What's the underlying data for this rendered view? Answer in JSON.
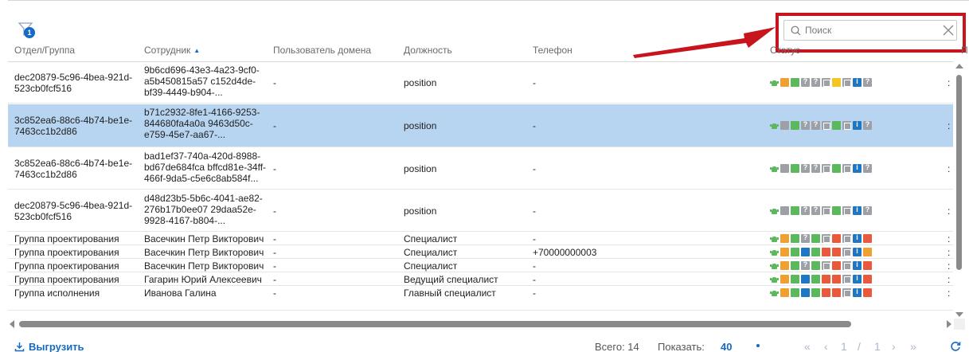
{
  "filter": {
    "badge_count": "1",
    "icon": "funnel-icon"
  },
  "search": {
    "placeholder": "Поиск",
    "value": ""
  },
  "columns": {
    "department": "Отдел/Группа",
    "employee": "Сотрудник",
    "domain_user": "Пользователь домена",
    "position": "Должность",
    "phone": "Телефон",
    "status": "Статус",
    "extra": "П"
  },
  "status_colors": {
    "green": "#5cb85c",
    "orange": "#f0a030",
    "red": "#e95a3c",
    "yellow": "#f3c623",
    "blue": "#1f77c4",
    "gray": "#9da0a5"
  },
  "rows": [
    {
      "department": "dec20879-5c96-4bea-921d-523cb0fcf516",
      "employee": "9b6cd696-43e3-4a23-9cf0-a5b450815a57 c152d4de-bf39-4449-b904-...",
      "domain_user": "-",
      "position": "position",
      "phone": "-",
      "selected": false,
      "status_icons": [
        "android",
        "o",
        "g",
        "gr-q",
        "gr-q",
        "gr-box",
        "y",
        "gr-box",
        "b-inf",
        "gr-q"
      ]
    },
    {
      "department": "3c852ea6-88c6-4b74-be1e-7463cc1b2d86",
      "employee": "b71c2932-8fe1-4166-9253-844680fa4a0a 9463d50c-e759-45e7-aa67-...",
      "domain_user": "-",
      "position": "position",
      "phone": "-",
      "selected": true,
      "status_icons": [
        "android",
        "gr",
        "g",
        "gr-q",
        "gr-q",
        "gr-box",
        "g",
        "gr-box",
        "b-inf",
        "gr-q"
      ]
    },
    {
      "department": "3c852ea6-88c6-4b74-be1e-7463cc1b2d86",
      "employee": "bad1ef37-740a-420d-8988-bd67de684fca bffcd81e-34ff-466f-9da5-c5e6c8ab584f...",
      "domain_user": "-",
      "position": "position",
      "phone": "-",
      "selected": false,
      "status_icons": [
        "android",
        "gr",
        "g",
        "gr-q",
        "gr-q",
        "gr-box",
        "g",
        "gr-box",
        "b-inf",
        "gr-q"
      ]
    },
    {
      "department": "dec20879-5c96-4bea-921d-523cb0fcf516",
      "employee": "d48d23b5-5b6c-4041-ae82-276b17b0ee07 29daa52e-9928-4167-b804-...",
      "domain_user": "-",
      "position": "position",
      "phone": "-",
      "selected": false,
      "status_icons": [
        "android",
        "gr",
        "g",
        "gr-q",
        "gr-q",
        "gr-box",
        "g",
        "gr-box",
        "b-inf",
        "gr-q"
      ]
    },
    {
      "department": "Группа проектирования",
      "employee": "Васечкин Петр Викторович",
      "domain_user": "-",
      "position": "Специалист",
      "phone": "-",
      "selected": false,
      "status_icons": [
        "android",
        "o",
        "g",
        "gr-q",
        "g",
        "gr-box",
        "r",
        "gr-box",
        "b-inf",
        "r"
      ]
    },
    {
      "department": "Группа проектирования",
      "employee": "Васечкин Петр Викторович",
      "domain_user": "-",
      "position": "Специалист",
      "phone": "+70000000003",
      "selected": false,
      "status_icons": [
        "android",
        "o",
        "g",
        "b",
        "g",
        "r",
        "r",
        "gr-box",
        "b-inf",
        "o"
      ]
    },
    {
      "department": "Группа проектирования",
      "employee": "Васечкин Петр Викторович",
      "domain_user": "-",
      "position": "Специалист",
      "phone": "-",
      "selected": false,
      "status_icons": [
        "android",
        "o",
        "g",
        "gr-q",
        "g",
        "gr-box",
        "r",
        "gr-box",
        "b-inf",
        "r"
      ]
    },
    {
      "department": "Группа проектирования",
      "employee": "Гагарин Юрий Алексеевич",
      "domain_user": "-",
      "position": "Ведущий специалист",
      "phone": "-",
      "selected": false,
      "status_icons": [
        "android",
        "o",
        "g",
        "b",
        "g",
        "r",
        "r",
        "gr-box",
        "b-inf",
        "r"
      ]
    },
    {
      "department": "Группа исполнения",
      "employee": "Иванова Галина",
      "domain_user": "-",
      "position": "Главный специалист",
      "phone": "-",
      "selected": false,
      "status_icons": [
        "android",
        "o",
        "g",
        "b",
        "g",
        "r",
        "r",
        "gr-box",
        "b-inf",
        "r"
      ]
    }
  ],
  "footer": {
    "export_label": "Выгрузить",
    "total_label": "Всего: 14",
    "show_label": "Показать:",
    "show_value": "40",
    "page_current": "1",
    "page_sep": "/",
    "page_total": "1"
  },
  "annotation_color": "#c8141c"
}
